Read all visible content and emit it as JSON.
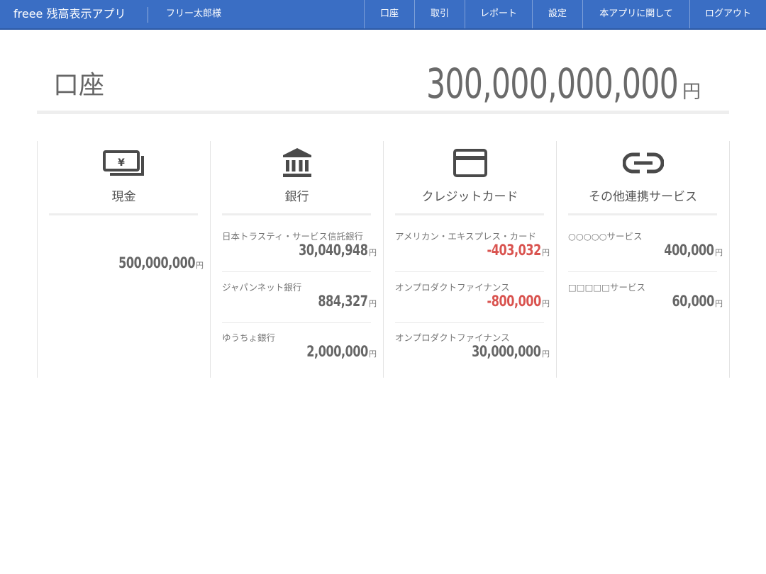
{
  "navbar": {
    "brand": "freee 残高表示アプリ",
    "user": "フリー太郎様",
    "items": [
      {
        "label": "口座"
      },
      {
        "label": "取引"
      },
      {
        "label": "レポート"
      },
      {
        "label": "設定"
      },
      {
        "label": "本アプリに関して"
      },
      {
        "label": "ログアウト"
      }
    ]
  },
  "header": {
    "title": "口座",
    "total_amount": "300,000,000,000",
    "total_unit": "円"
  },
  "colors": {
    "navbar": "#3a6ec4",
    "negative": "#d9534f",
    "icon": "#4a4a4a"
  },
  "columns": [
    {
      "icon": "cash-icon",
      "title": "現金",
      "accounts": [
        {
          "name": "",
          "amount": "500,000,000",
          "unit": "円",
          "negative": false
        }
      ]
    },
    {
      "icon": "bank-icon",
      "title": "銀行",
      "accounts": [
        {
          "name": "日本トラスティ・サービス信託銀行",
          "amount": "30,040,948",
          "unit": "円",
          "negative": false
        },
        {
          "name": "ジャパンネット銀行",
          "amount": "884,327",
          "unit": "円",
          "negative": false
        },
        {
          "name": "ゆうちょ銀行",
          "amount": "2,000,000",
          "unit": "円",
          "negative": false
        }
      ]
    },
    {
      "icon": "credit-card-icon",
      "title": "クレジットカード",
      "accounts": [
        {
          "name": "アメリカン・エキスプレス・カード",
          "amount": "-403,032",
          "unit": "円",
          "negative": true
        },
        {
          "name": "オンプロダクトファイナンス",
          "amount": "-800,000",
          "unit": "円",
          "negative": true
        },
        {
          "name": "オンプロダクトファイナンス",
          "amount": "30,000,000",
          "unit": "円",
          "negative": false
        }
      ]
    },
    {
      "icon": "link-icon",
      "title": "その他連携サービス",
      "accounts": [
        {
          "name": "○○○○○サービス",
          "amount": "400,000",
          "unit": "円",
          "negative": false
        },
        {
          "name": "□□□□□サービス",
          "amount": "60,000",
          "unit": "円",
          "negative": false
        }
      ]
    }
  ]
}
